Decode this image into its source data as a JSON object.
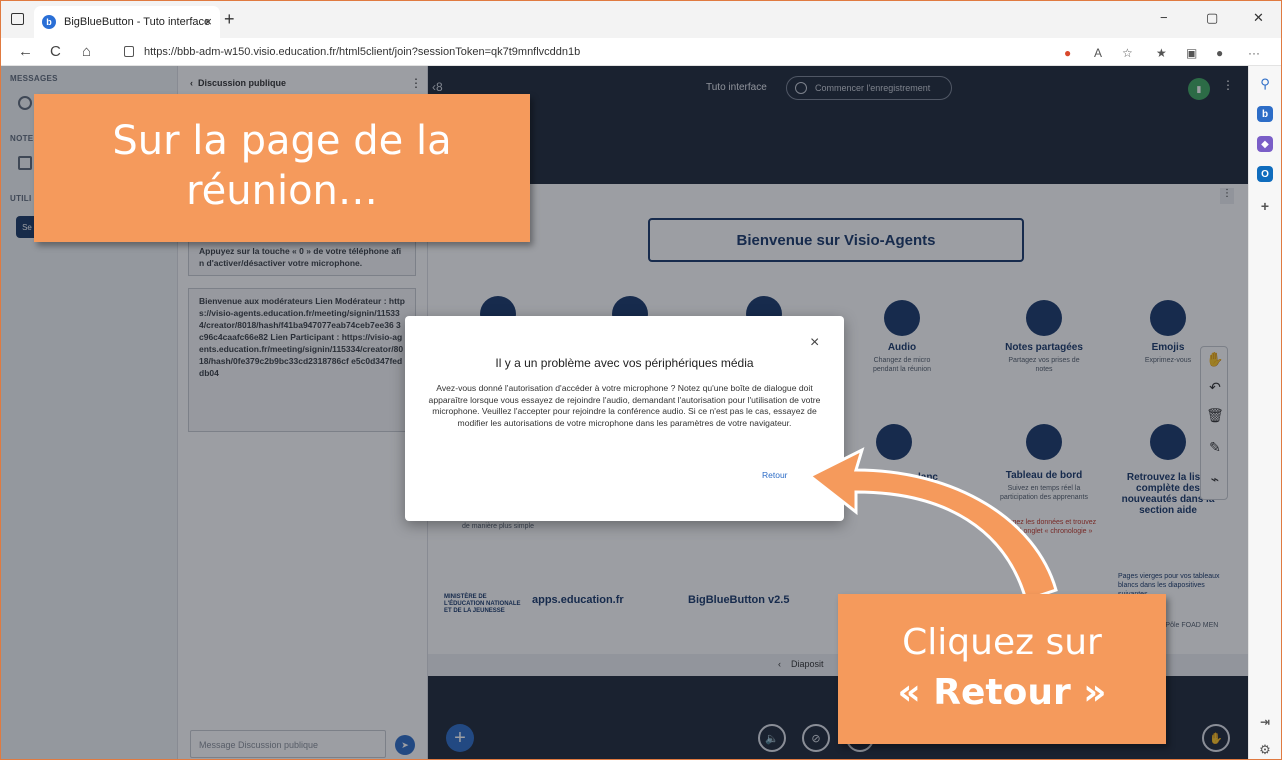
{
  "browser": {
    "tab_title": "BigBlueButton - Tuto interface",
    "tab_close": "×",
    "new_tab": "+",
    "url": "https://bbb-adm-w150.visio.education.fr/html5client/join?sessionToken=qk7t9mnflvcddn1b",
    "window_controls": [
      "−",
      "▢",
      "✕"
    ],
    "nav": {
      "back": "←",
      "reload": "C",
      "home": "⌂"
    },
    "more": "···"
  },
  "left_panel": {
    "messages_label": "MESSAGES",
    "notes_label": "NOTE",
    "users_label": "UTILI"
  },
  "chat": {
    "header": "Discussion publique",
    "messages": [
      "Appuyez sur la touche « 0 » de votre téléphone afin d'activer/désactiver votre microphone.",
      "Bienvenue aux modérateurs Lien Modérateur : https://visio-agents.education.fr/meeting/signin/115334/creator/8018/hash/f41ba947077eab74ceb7ee36 3c96c4caafc66e82 Lien Participant : https://visio-agents.education.fr/meeting/signin/115334/creator/8018/hash/0fe379c2b9bc33cd2318786cf e5c0d347feddb04"
    ],
    "input_placeholder": "Message Discussion publique"
  },
  "top_bar": {
    "session_title": "Tuto interface",
    "record_label": "Commencer l'enregistrement"
  },
  "slide": {
    "welcome": "Bienvenue sur Visio-Agents",
    "features": [
      {
        "title": "Audio",
        "desc": "Changez de micro pendant la réunion"
      },
      {
        "title": "Notes partagées",
        "desc": "Partagez vos prises de notes"
      },
      {
        "title": "Emojis",
        "desc": "Exprimez-vous"
      },
      {
        "title": "Tableau de bord",
        "desc": "Suivez en temps réel la participation des apprenants"
      },
      {
        "title": "Retrouvez la liste complète des nouveautés dans la section aide",
        "desc": ""
      }
    ],
    "partial_texts": {
      "blanc": "lanc",
      "simple": "de manière plus simple",
      "dashboard_refresh": "Rechargez les données et trouvez le nouvel onglet « chronologie »"
    },
    "pages_hint": "Pages vierges pour vos tableaux blancs dans les diapositives suivantes",
    "logos": {
      "ministry": "MINISTÈRE DE L'ÉDUCATION NATIONALE ET DE LA JEUNESSE",
      "apps": "apps.education.fr",
      "bbb": "BigBlueButton v2.5"
    },
    "credit": "RY Pôle FOAD MEN",
    "nav_label": "Diaposit"
  },
  "modal": {
    "title": "Il y a un problème avec vos périphériques média",
    "body": "Avez-vous donné l'autorisation d'accéder à votre microphone ? Notez qu'une boîte de dialogue doit apparaître lorsque vous essayez de rejoindre l'audio, demandant l'autorisation pour l'utilisation de votre microphone. Veuillez l'accepter pour rejoindre la conférence audio. Si ce n'est pas le cas, essayez de modifier les autorisations de votre microphone dans les paramètres de votre navigateur.",
    "back_label": "Retour",
    "close": "×"
  },
  "callouts": {
    "first": "Sur la page de la réunion…",
    "second_prefix": "Cliquez sur",
    "second_bold": "« Retour »"
  },
  "colors": {
    "callout": "#f59a5c",
    "app_dark": "#202a3a",
    "primary_blue": "#2d6dc7",
    "slide_navy": "#1a3a6b"
  }
}
